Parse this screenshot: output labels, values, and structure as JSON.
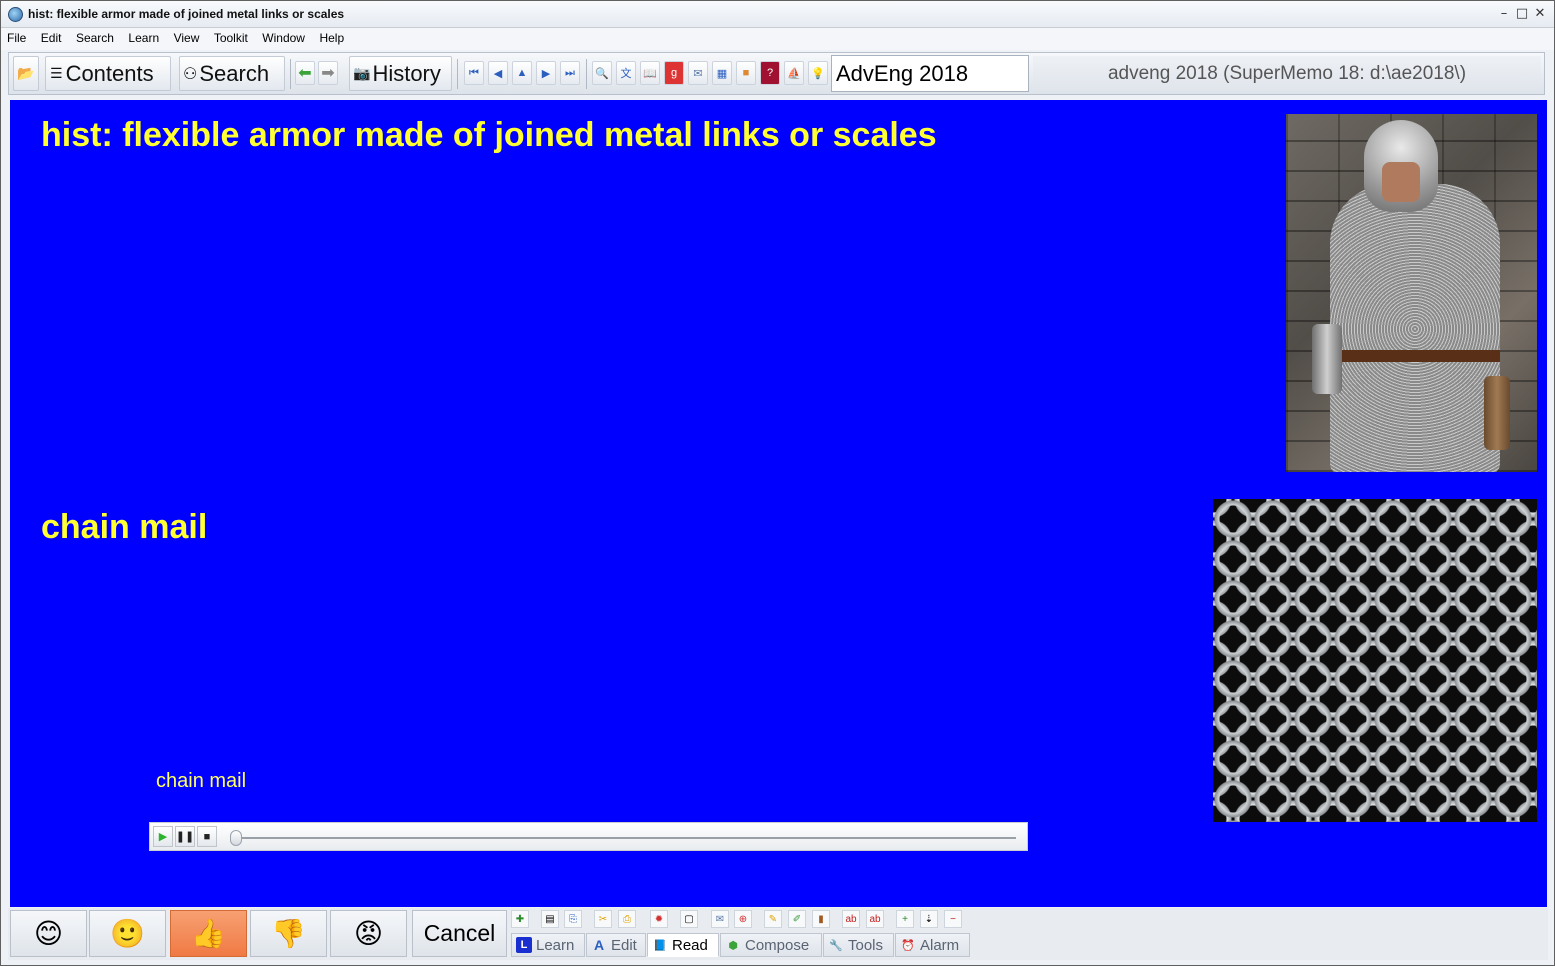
{
  "window": {
    "title": "hist: flexible armor made of joined metal links or scales",
    "controls": {
      "minimize": "–",
      "maximize": "□",
      "close": "✕"
    }
  },
  "menu": [
    "File",
    "Edit",
    "Search",
    "Learn",
    "View",
    "Toolkit",
    "Window",
    "Help"
  ],
  "toolbar": {
    "contents_label": "Contents",
    "search_label": "Search",
    "history_label": "History",
    "collection_value": "AdvEng 2018",
    "status": "adveng 2018 (SuperMemo 18: d:\\ae2018\\)"
  },
  "element": {
    "question": "hist: flexible armor made of joined metal links or scales",
    "answer": "chain mail",
    "sound_label": "chain mail"
  },
  "media_player": {
    "progress": 0
  },
  "grades": {
    "icons": [
      "😊",
      "🙂",
      "👍",
      "👎",
      "😡"
    ],
    "selected_index": 2,
    "cancel_label": "Cancel"
  },
  "tabs": [
    {
      "label": "Learn",
      "icon": "L",
      "active": false
    },
    {
      "label": "Edit",
      "icon": "A",
      "active": false
    },
    {
      "label": "Read",
      "icon": "📘",
      "active": true
    },
    {
      "label": "Compose",
      "icon": "⬢",
      "active": false
    },
    {
      "label": "Tools",
      "icon": "🔧",
      "active": false
    },
    {
      "label": "Alarm",
      "icon": "⏰",
      "active": false
    }
  ],
  "colors": {
    "background": "#0000ff",
    "text": "#ffff33",
    "selected_grade": "#f07a44"
  }
}
